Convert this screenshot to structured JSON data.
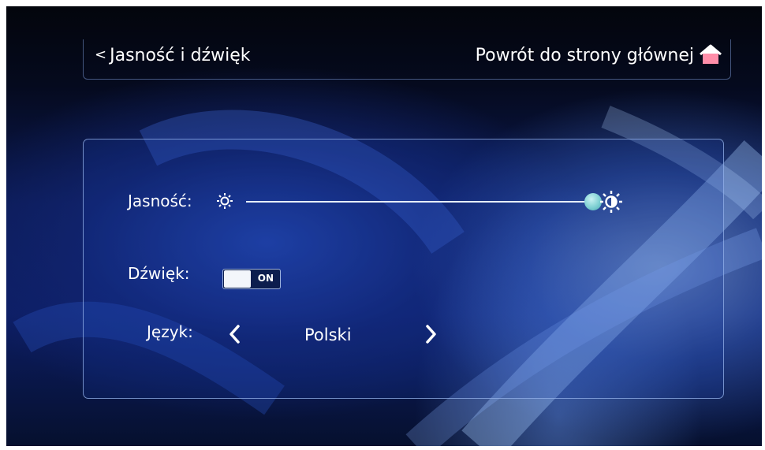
{
  "header": {
    "back_label": "Jasność i dźwięk",
    "home_label": "Powrót do strony głównej"
  },
  "brightness": {
    "label": "Jasność:",
    "level_fraction": 1.0
  },
  "sound": {
    "label": "Dźwięk:",
    "state_text": "ON"
  },
  "language": {
    "label": "Język:",
    "value": "Polski"
  },
  "colors": {
    "accent": "#7fd0d3",
    "text": "#ffffff",
    "panel_border": "#96b4eb"
  },
  "icons": [
    "chevron-left-icon",
    "home-icon",
    "sun-small-icon",
    "sun-large-icon",
    "chevron-right-icon"
  ]
}
